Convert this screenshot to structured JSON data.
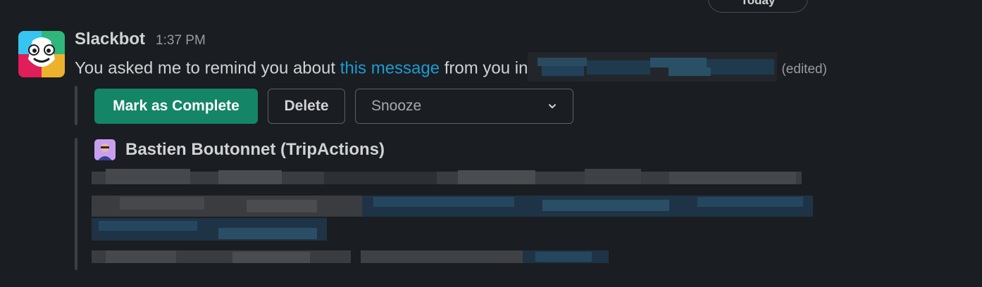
{
  "divider": {
    "day_label": "Today"
  },
  "message": {
    "sender": "Slackbot",
    "time": "1:37 PM",
    "text_before": "You asked me to remind you about ",
    "link_text": "this message",
    "text_after": " from you in",
    "edited": "(edited)"
  },
  "actions": {
    "complete_label": "Mark as Complete",
    "delete_label": "Delete",
    "snooze_placeholder": "Snooze"
  },
  "quoted": {
    "author": "Bastien Boutonnet (TripActions)"
  },
  "colors": {
    "background": "#1a1d21",
    "primary_button": "#148567",
    "link": "#1d9bd1"
  },
  "icons": [
    "slackbot-avatar-icon",
    "chevron-down-icon",
    "user-avatar-icon"
  ]
}
